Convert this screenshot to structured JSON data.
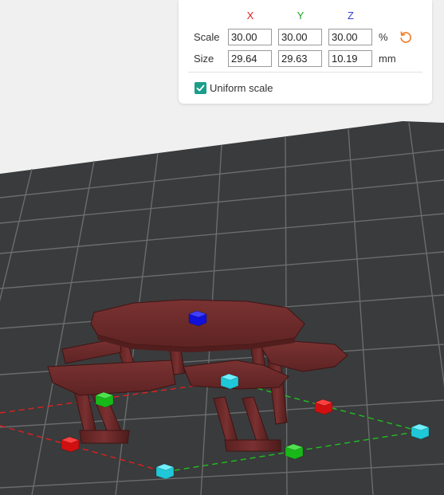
{
  "panel": {
    "axes": {
      "x": "X",
      "y": "Y",
      "z": "Z"
    },
    "colors": {
      "x": "#e02020",
      "y": "#1fa31f",
      "z": "#2f3fd0",
      "accent": "#1a9e8a",
      "reset": "#f07f2a"
    },
    "scale": {
      "label": "Scale",
      "x": "30.00",
      "y": "30.00",
      "z": "30.00",
      "unit": "%"
    },
    "size": {
      "label": "Size",
      "x": "29.64",
      "y": "29.63",
      "z": "10.19",
      "unit": "mm"
    },
    "uniform_scale": {
      "label": "Uniform scale",
      "checked": true
    },
    "reset_icon": "reset-arrow-icon"
  },
  "viewport": {
    "bed_color": "#3a3b3c",
    "grid_color": "#6a6b6c",
    "model_color": "#6e2a2a",
    "handle_colors": {
      "x": "#d01010",
      "y": "#18b818",
      "z": "#1010d8",
      "corner": "#1ec8d8"
    }
  }
}
